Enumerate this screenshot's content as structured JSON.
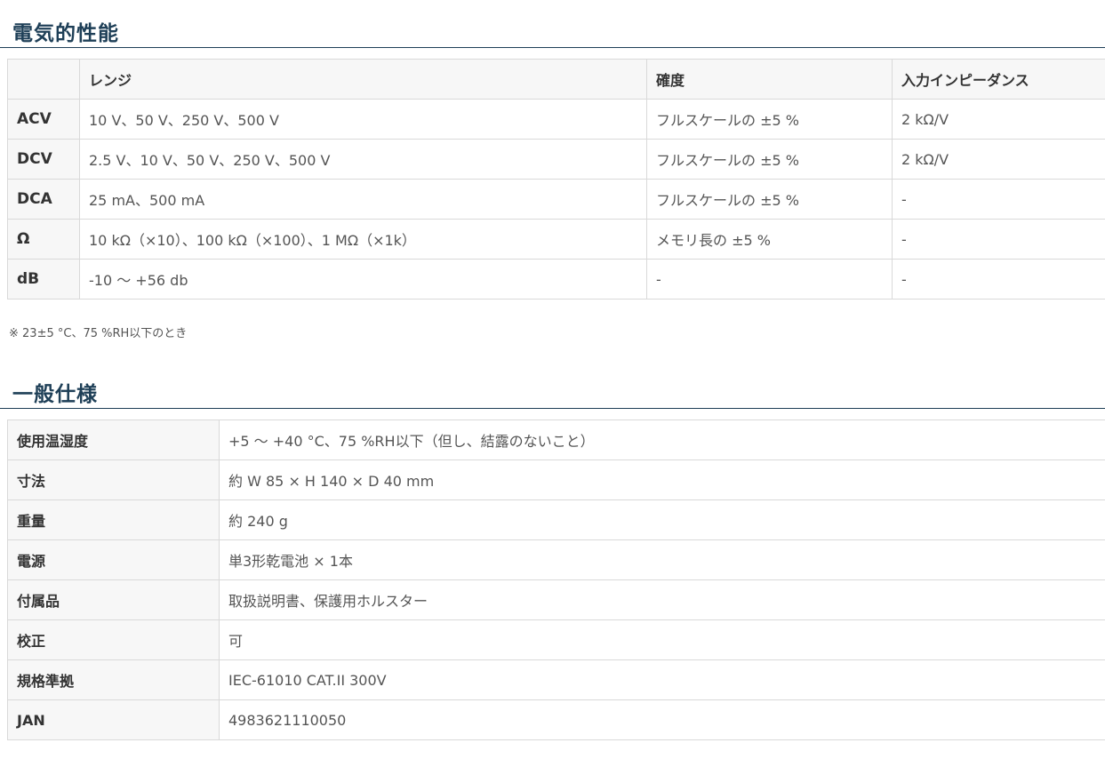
{
  "electrical": {
    "title": "電気的性能",
    "headers": [
      "",
      "レンジ",
      "確度",
      "入力インピーダンス"
    ],
    "rows": [
      {
        "label": "ACV",
        "range": "10 V、50 V、250 V、500 V",
        "accuracy": "フルスケールの ±5 %",
        "impedance": "2 kΩ/V"
      },
      {
        "label": "DCV",
        "range": "2.5 V、10 V、50 V、250 V、500 V",
        "accuracy": "フルスケールの ±5 %",
        "impedance": "2 kΩ/V"
      },
      {
        "label": "DCA",
        "range": "25 mA、500 mA",
        "accuracy": "フルスケールの ±5 %",
        "impedance": "-"
      },
      {
        "label": "Ω",
        "range": "10 kΩ（×10）、100 kΩ（×100）、1 MΩ（×1k）",
        "accuracy": "メモリ長の ±5 %",
        "impedance": "-"
      },
      {
        "label": "dB",
        "range": "-10 〜 +56 db",
        "accuracy": "-",
        "impedance": "-"
      }
    ],
    "note": "※ 23±5 °C、75 %RH以下のとき"
  },
  "general": {
    "title": "一般仕様",
    "rows": [
      {
        "label": "使用温湿度",
        "value": "+5 〜 +40 °C、75 %RH以下（但し、結露のないこと）"
      },
      {
        "label": "寸法",
        "value": "約 W 85 × H 140 × D 40 mm"
      },
      {
        "label": "重量",
        "value": "約 240 g"
      },
      {
        "label": "電源",
        "value": "単3形乾電池 × 1本"
      },
      {
        "label": "付属品",
        "value": "取扱説明書、保護用ホルスター"
      },
      {
        "label": "校正",
        "value": "可"
      },
      {
        "label": "規格準拠",
        "value": "IEC-61010 CAT.II 300V"
      },
      {
        "label": "JAN",
        "value": "4983621110050"
      }
    ]
  },
  "colors": {
    "heading": "#1e3f57",
    "header_bg": "#f7f7f7",
    "border": "#d9d9d9"
  }
}
